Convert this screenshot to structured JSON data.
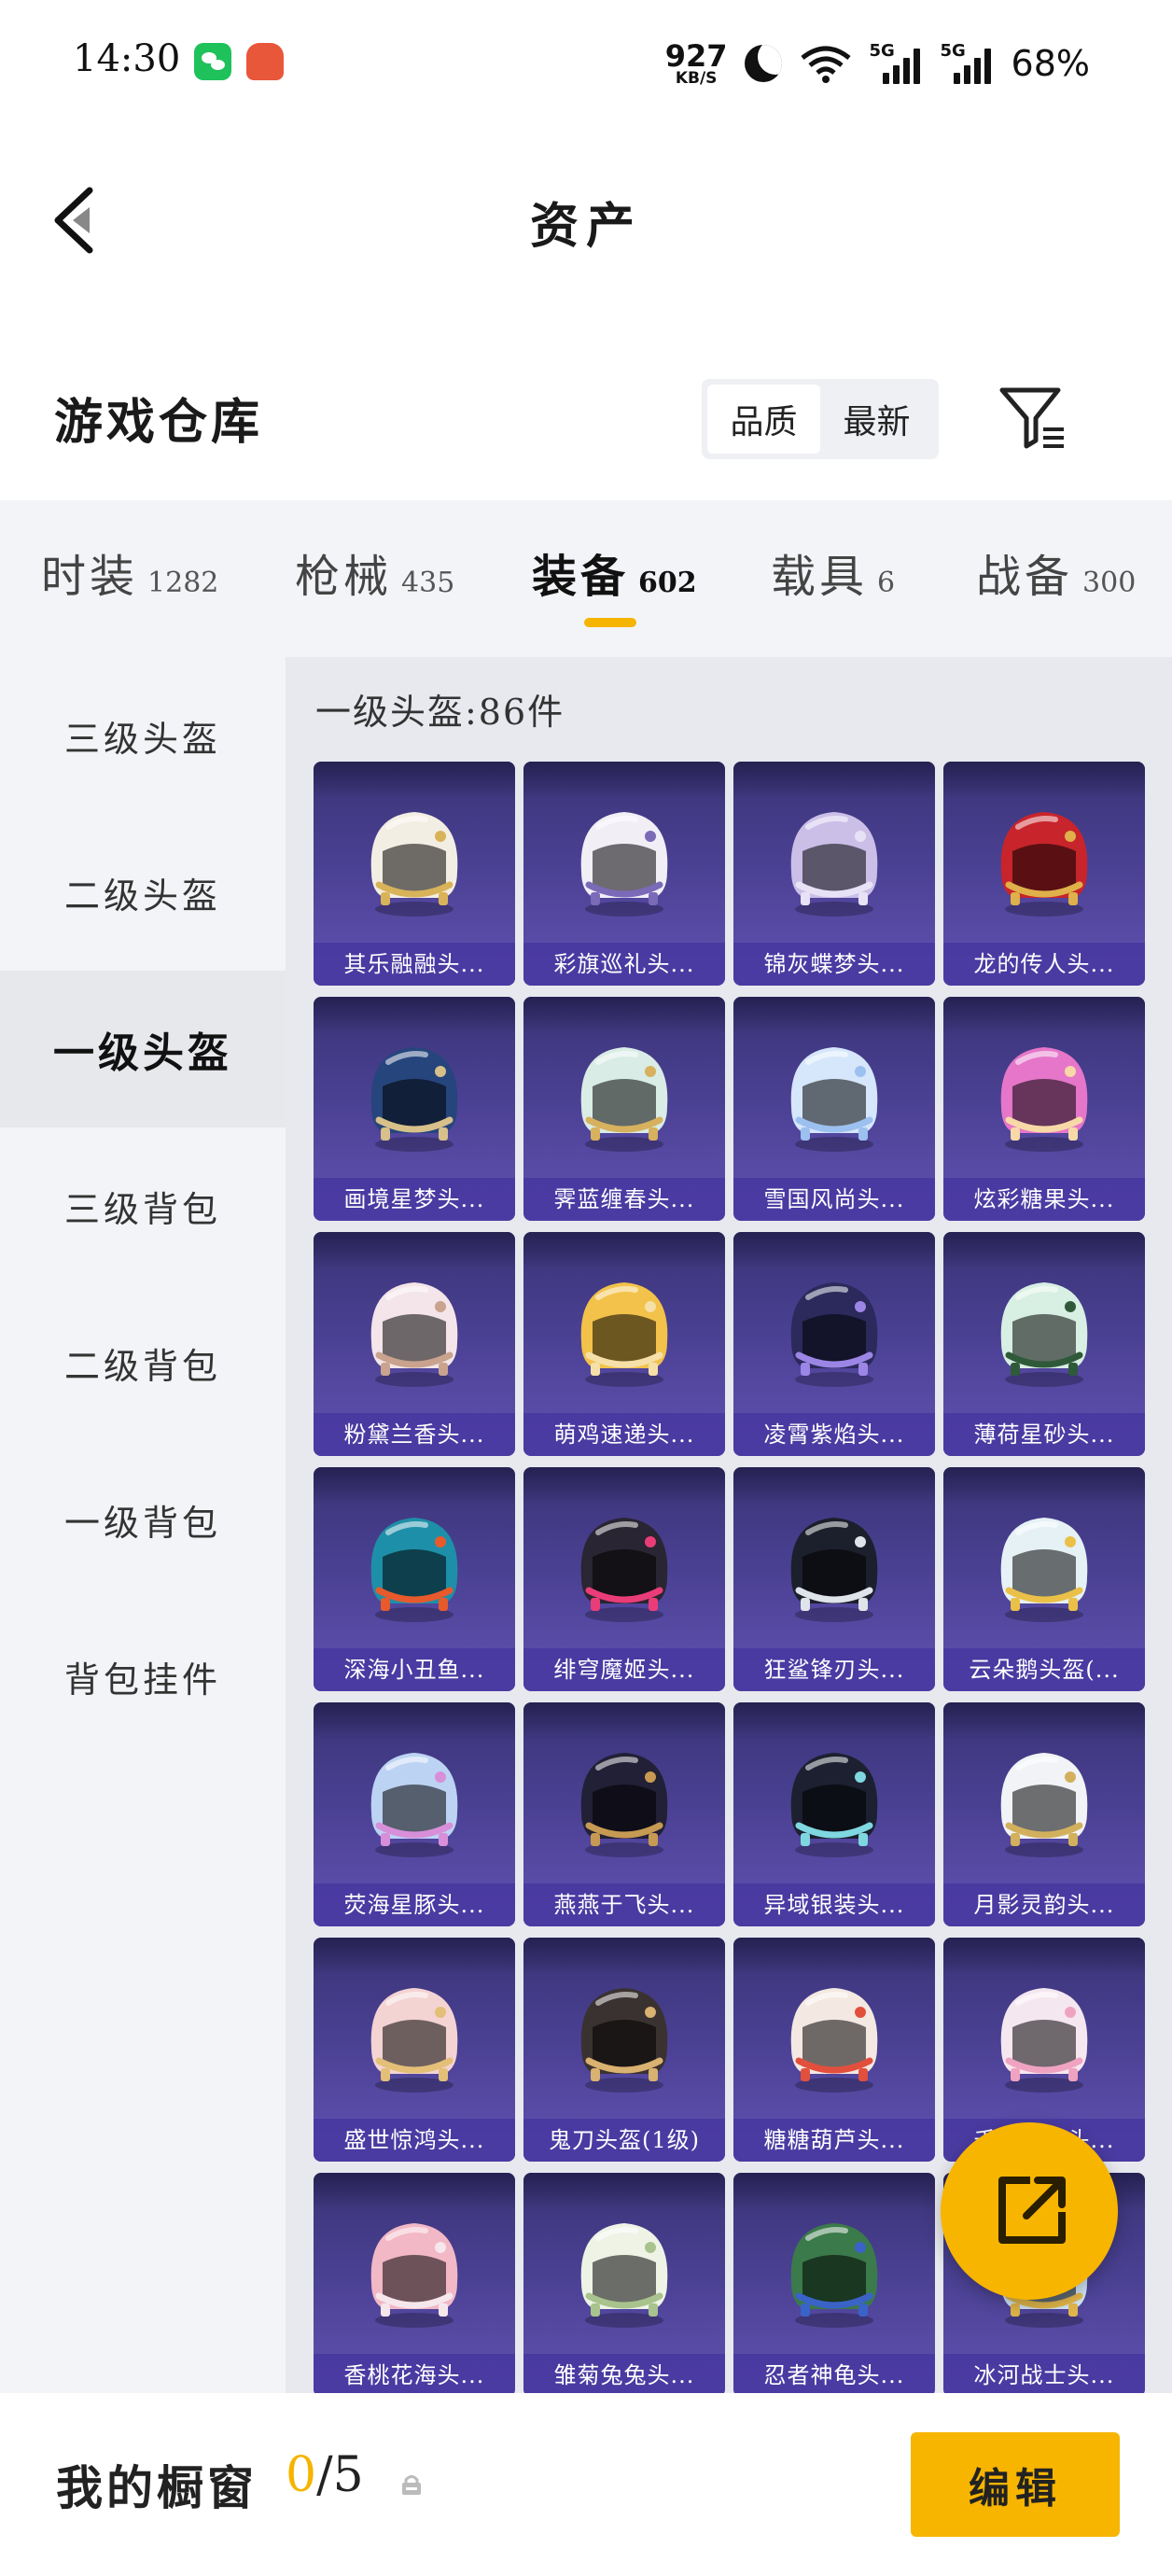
{
  "status_bar": {
    "time": "14:30",
    "speed_value": "927",
    "speed_unit": "KB/S",
    "signal_label_1": "5G",
    "signal_label_2": "5G",
    "battery": "68%"
  },
  "header": {
    "title": "资产"
  },
  "warehouse": {
    "title": "游戏仓库",
    "sort_options": [
      "品质",
      "最新"
    ],
    "active_sort": "品质"
  },
  "tabs": [
    {
      "name": "时装",
      "count": "1282"
    },
    {
      "name": "枪械",
      "count": "435"
    },
    {
      "name": "装备",
      "count": "602"
    },
    {
      "name": "载具",
      "count": "6"
    },
    {
      "name": "战备",
      "count": "300"
    }
  ],
  "active_tab": "装备",
  "side_nav": [
    "三级头盔",
    "二级头盔",
    "一级头盔",
    "三级背包",
    "二级背包",
    "一级背包",
    "背包挂件"
  ],
  "active_side": "一级头盔",
  "content_title": "一级头盔:86件",
  "items": [
    {
      "name": "其乐融融头...",
      "color": "#f3eee3",
      "accent": "#d9b35a"
    },
    {
      "name": "彩旗巡礼头...",
      "color": "#f1eef6",
      "accent": "#7a6ab8"
    },
    {
      "name": "锦灰蝶梦头...",
      "color": "#cbbfe8",
      "accent": "#e8e2f6"
    },
    {
      "name": "龙的传人头...",
      "color": "#c8242b",
      "accent": "#e0b04a"
    },
    {
      "name": "画境星梦头...",
      "color": "#26457d",
      "accent": "#d7c08a"
    },
    {
      "name": "霁蓝缠春头...",
      "color": "#d9ece6",
      "accent": "#d7b15e"
    },
    {
      "name": "雪国风尚头...",
      "color": "#d6e6fb",
      "accent": "#9cc0ef"
    },
    {
      "name": "炫彩糖果头...",
      "color": "#e576c9",
      "accent": "#f7d9a8"
    },
    {
      "name": "粉黛兰香头...",
      "color": "#f3e5e9",
      "accent": "#c9a38d"
    },
    {
      "name": "萌鸡速递头...",
      "color": "#f2c24a",
      "accent": "#f6e0a8"
    },
    {
      "name": "凌霄紫焰头...",
      "color": "#2c2a5c",
      "accent": "#9b86e6"
    },
    {
      "name": "薄荷星砂头...",
      "color": "#d8efe3",
      "accent": "#2f5a3a"
    },
    {
      "name": "深海小丑鱼...",
      "color": "#1e8fa8",
      "accent": "#e85a2c"
    },
    {
      "name": "绯穹魔姬头...",
      "color": "#2a2532",
      "accent": "#ea3d78"
    },
    {
      "name": "狂鲨锋刃头...",
      "color": "#1c1f2c",
      "accent": "#dfe3ea"
    },
    {
      "name": "云朵鹅头盔(...",
      "color": "#e6f1f6",
      "accent": "#eac048"
    },
    {
      "name": "荧海星豚头...",
      "color": "#bcd3f3",
      "accent": "#d88fd9"
    },
    {
      "name": "燕燕于飞头...",
      "color": "#222036",
      "accent": "#c79a53"
    },
    {
      "name": "异域银装头...",
      "color": "#1c2030",
      "accent": "#7fd7e0"
    },
    {
      "name": "月影灵韵头...",
      "color": "#f2f3f7",
      "accent": "#d2b05d"
    },
    {
      "name": "盛世惊鸿头...",
      "color": "#f4d3d3",
      "accent": "#e3bf78"
    },
    {
      "name": "鬼刀头盔(1级)",
      "color": "#3a3231",
      "accent": "#d9b170"
    },
    {
      "name": "糖糖葫芦头...",
      "color": "#f3e9e2",
      "accent": "#e24f3d"
    },
    {
      "name": "千仓灵猫头...",
      "color": "#f5e7f0",
      "accent": "#f0a3c1"
    },
    {
      "name": "香桃花海头...",
      "color": "#f2b8c6",
      "accent": "#f5e7ec"
    },
    {
      "name": "雏菊兔兔头...",
      "color": "#eef3e6",
      "accent": "#a8c38e"
    },
    {
      "name": "忍者神龟头...",
      "color": "#3b7a4a",
      "accent": "#3a63c8"
    },
    {
      "name": "冰河战士头...",
      "color": "#cfe3f5",
      "accent": "#e0b64a"
    }
  ],
  "showcase": {
    "label": "我的橱窗",
    "current": "0",
    "total": "/5"
  },
  "edit_button": "编辑"
}
